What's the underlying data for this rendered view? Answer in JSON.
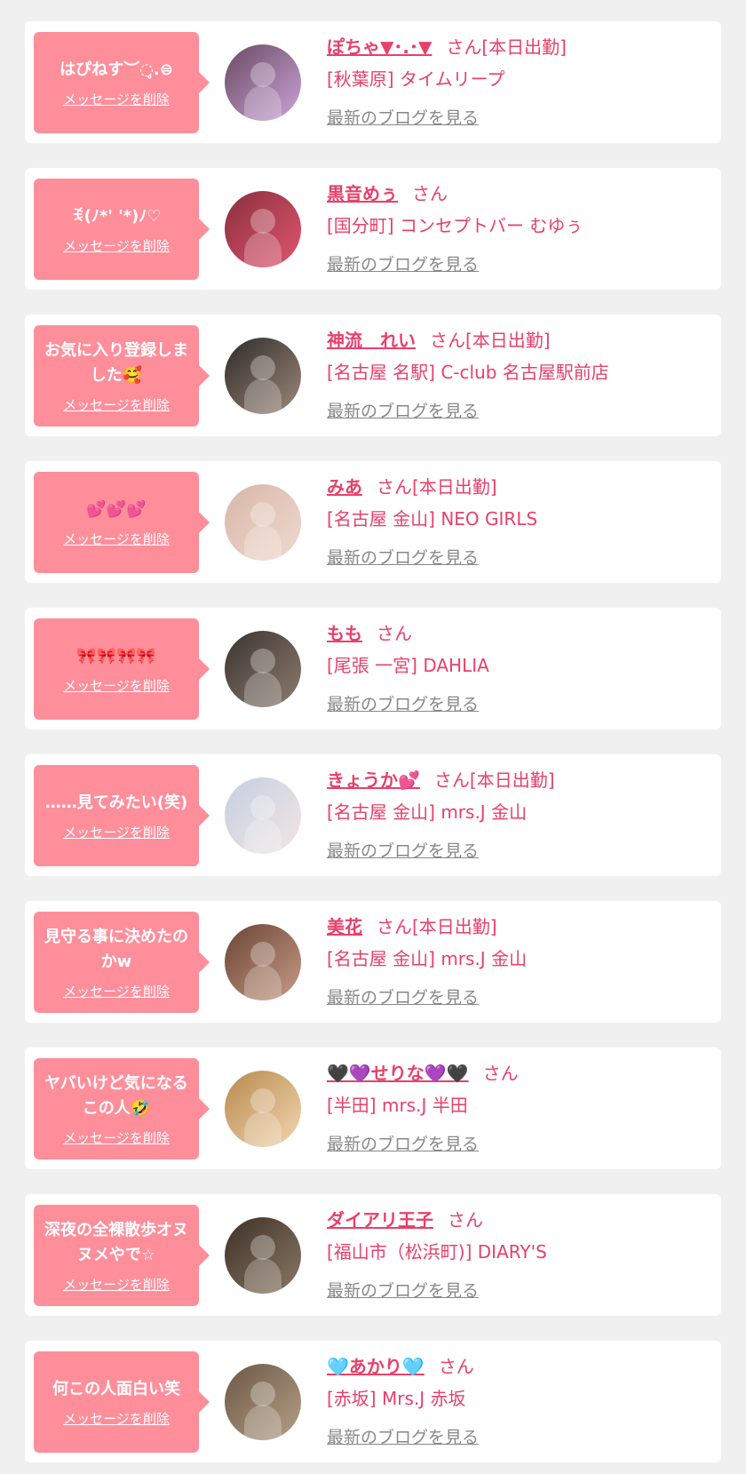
{
  "delete_label": "メッセージを削除",
  "blog_label": "最新のブログを見る",
  "san": "さん",
  "colors": {
    "accent": "#e8406a",
    "bubble": "#ff8e9b",
    "link_gray": "#888888",
    "background": "#f0f0f0"
  },
  "items": [
    {
      "message": "はぴねす︶◌̥.⊜",
      "name": "ぽちゃ▼･.･▼",
      "status": "[本日出勤]",
      "area": "[秋葉原]",
      "shop": "タイムリープ",
      "avatar_colors": [
        "#6b4a63",
        "#c9a3d8"
      ]
    },
    {
      "message": "ꉂ(ﾉ*' '*)ﾉ♡",
      "name": "黒音めぅ",
      "status": "",
      "area": "[国分町]",
      "shop": "コンセプトバー むゆぅ",
      "avatar_colors": [
        "#8a2f3e",
        "#e0556f"
      ]
    },
    {
      "message": "お気に入り登録しました🥰",
      "name": "神流　れい",
      "status": "[本日出勤]",
      "area": "[名古屋 名駅]",
      "shop": "C-club 名古屋駅前店",
      "avatar_colors": [
        "#2f2b2b",
        "#9c8878"
      ]
    },
    {
      "message": "💕💕💕",
      "name": "みあ",
      "status": "[本日出勤]",
      "area": "[名古屋 金山]",
      "shop": "NEO GIRLS",
      "avatar_colors": [
        "#d7b7a8",
        "#efd9cf"
      ]
    },
    {
      "message": "🎀🎀🎀🎀",
      "name": "もも",
      "status": "",
      "area": "[尾張 一宮]",
      "shop": "DAHLIA",
      "avatar_colors": [
        "#3b3430",
        "#8d7d70"
      ]
    },
    {
      "message": "……見てみたい(笑)",
      "name": "きょうか💕",
      "status": "[本日出勤]",
      "area": "[名古屋 金山]",
      "shop": "mrs.J 金山",
      "avatar_colors": [
        "#c5cfe2",
        "#f1e6e3"
      ]
    },
    {
      "message": "見守る事に決めたのかw",
      "name": "美花",
      "status": "[本日出勤]",
      "area": "[名古屋 金山]",
      "shop": "mrs.J 金山",
      "avatar_colors": [
        "#6b4537",
        "#c79a84"
      ]
    },
    {
      "message": "ヤバいけど気になるこの人🤣",
      "name": "🖤💜せりな💜🖤",
      "status": "",
      "area": "[半田]",
      "shop": "mrs.J 半田",
      "avatar_colors": [
        "#b78a4e",
        "#f2d6b0"
      ]
    },
    {
      "message": "深夜の全裸散歩オヌヌメやで☆",
      "name": "ダイアリ王子",
      "status": "",
      "area": "[福山市（松浜町)]",
      "shop": "DIARY'S",
      "avatar_colors": [
        "#3e3127",
        "#8a7865"
      ]
    },
    {
      "message": "何この人面白い笑",
      "name": "🩵あかり🩵",
      "status": "",
      "area": "[赤坂]",
      "shop": "Mrs.J 赤坂",
      "avatar_colors": [
        "#6b5846",
        "#b59f86"
      ]
    }
  ]
}
